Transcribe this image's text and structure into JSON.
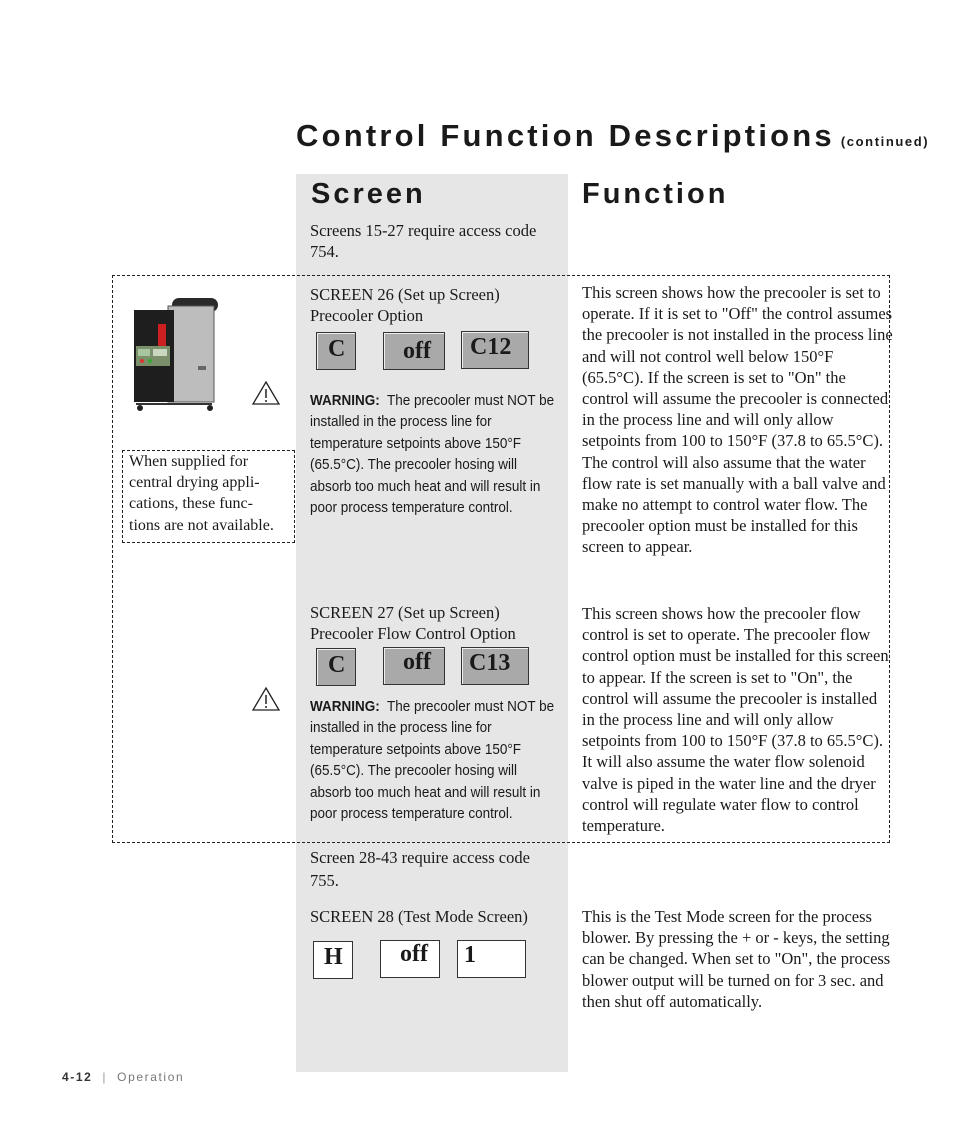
{
  "page": {
    "title": "Control Function Descriptions",
    "title_suffix": "(continued)"
  },
  "columns": {
    "screen_header": "Screen",
    "function_header": "Function"
  },
  "access_notes": {
    "screens_15_27": "Screens 15-27 require access code 754.",
    "screens_28_43": "Screen 28-43 require access code 755."
  },
  "side_note": "When supplied for central drying applications, these functions are not available.",
  "side_note_lines": [
    "When supplied for",
    "central drying appli-",
    "cations, these func-",
    "tions are not available."
  ],
  "icons": {
    "machine": "dryer-unit-illustration",
    "warning": "warning-triangle-icon"
  },
  "screens": [
    {
      "title": "SCREEN 26 (Set up Screen)",
      "subtitle": "Precooler Option",
      "display": {
        "mode": "C",
        "value": "off",
        "code": "C12",
        "style": "gray"
      },
      "warning_label": "WARNING:",
      "warning_text": "The precooler must NOT be installed in the process line for temperature setpoints above 150°F (65.5°C). The precooler hosing will absorb too much heat and will result in poor process temperature control.",
      "function_text": "This screen shows how the precooler is set to operate. If it is set to \"Off\" the control assumes the precooler is not installed in the process line and will not control well below 150°F (65.5°C). If the screen is set to \"On\" the control will assume the precooler is connected in the process line and will only allow setpoints from 100 to 150°F (37.8 to 65.5°C). The control will also assume that the water flow rate is set manually with a ball valve and make no attempt to control water flow. The precooler option must be installed for this screen to appear."
    },
    {
      "title": "SCREEN 27 (Set up Screen)",
      "subtitle": "Precooler Flow Control Option",
      "display": {
        "mode": "C",
        "value": "off",
        "code": "C13",
        "style": "gray"
      },
      "warning_label": "WARNING:",
      "warning_text": "The precooler must NOT be installed in the process line for temperature setpoints above 150°F (65.5°C). The precooler hosing will absorb too much heat and will result in poor process temperature control.",
      "function_text": "This screen shows how the precooler flow control is set to operate. The precooler flow control option must be installed for this screen to appear. If the screen is set to \"On\", the control will assume the precooler is installed in the process line and will only allow setpoints from 100 to 150°F (37.8 to 65.5°C). It will also assume the water flow solenoid valve is piped in the water line and the dryer control will regulate water flow to control temperature."
    },
    {
      "title": "SCREEN 28 (Test Mode Screen)",
      "subtitle": "",
      "display": {
        "mode": "H",
        "value": "off",
        "code": "1",
        "style": "white"
      },
      "function_text": "This is the Test Mode screen for the process blower. By pressing the + or - keys, the setting can be changed. When set to \"On\", the process blower output will be turned on for 3 sec. and then shut off automatically."
    }
  ],
  "footer": {
    "page_number": "4-12",
    "separator": "|",
    "section": "Operation"
  }
}
